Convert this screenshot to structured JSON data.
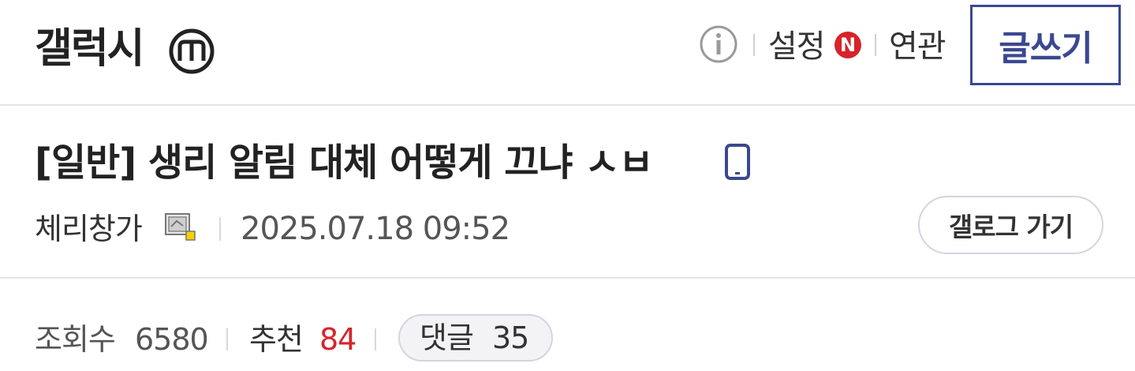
{
  "header": {
    "gallery_name": "갤럭시",
    "minor_badge_icon": "minor-gallery-m-icon",
    "info_icon": "info-icon",
    "settings_label": "설정",
    "new_badge_letter": "N",
    "related_label": "연관",
    "write_button_label": "글쓰기"
  },
  "post": {
    "title": "[일반] 생리 알림 대체 어떻게 끄냐 ㅅㅂ",
    "mobile_icon": "mobile-phone-icon",
    "author": "체리창가",
    "author_icon": "fixed-nick-icon",
    "date": "2025.07.18 09:52",
    "gallog_button_label": "갤로그 가기"
  },
  "stats": {
    "views_label": "조회수",
    "views_value": "6580",
    "recommend_label": "추천",
    "recommend_value": "84",
    "comments_label": "댓글",
    "comments_value": "35"
  },
  "colors": {
    "accent": "#3b4890",
    "red": "#d7232a",
    "divider": "#e4e4ec"
  }
}
